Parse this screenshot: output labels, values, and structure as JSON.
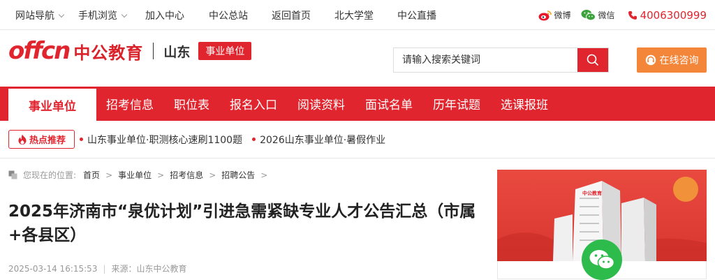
{
  "topbar": {
    "nav": [
      {
        "label": "网站导航",
        "dropdown": true
      },
      {
        "label": "手机浏览",
        "dropdown": true
      },
      {
        "label": "加入中心",
        "dropdown": false
      },
      {
        "label": "中公总站",
        "dropdown": false
      },
      {
        "label": "返回首页",
        "dropdown": false
      },
      {
        "label": "北大学堂",
        "dropdown": false
      },
      {
        "label": "中公直播",
        "dropdown": false
      }
    ],
    "weibo_label": "微博",
    "wechat_label": "微信",
    "phone": "4006300999"
  },
  "header": {
    "logo_en": "offcn",
    "logo_cn": "中公教育",
    "region": "山东",
    "category_badge": "事业单位",
    "search_placeholder": "请输入搜索关键词",
    "consult_label": "在线咨询"
  },
  "main_nav": {
    "active": "事业单位",
    "items": [
      "招考信息",
      "职位表",
      "报名入口",
      "阅读资料",
      "面试名单",
      "历年试题",
      "选课报班"
    ]
  },
  "hot": {
    "badge": "热点推荐",
    "items": [
      "山东事业单位·职测核心速刷1100题",
      "2026山东事业单位·暑假作业"
    ]
  },
  "breadcrumb": {
    "prefix": "您现在的位置:",
    "items": [
      "首页",
      "事业单位",
      "招考信息",
      "招聘公告"
    ]
  },
  "article": {
    "title": "2025年济南市“泉优计划”引进急需紧缺专业人才公告汇总（市属+各县区）",
    "date": "2025-03-14 16:15:53",
    "source": "来源：山东中公教育"
  },
  "colors": {
    "brand_red": "#e0252f",
    "consult_orange": "#f4863a",
    "wechat_green": "#2dbb4b"
  }
}
